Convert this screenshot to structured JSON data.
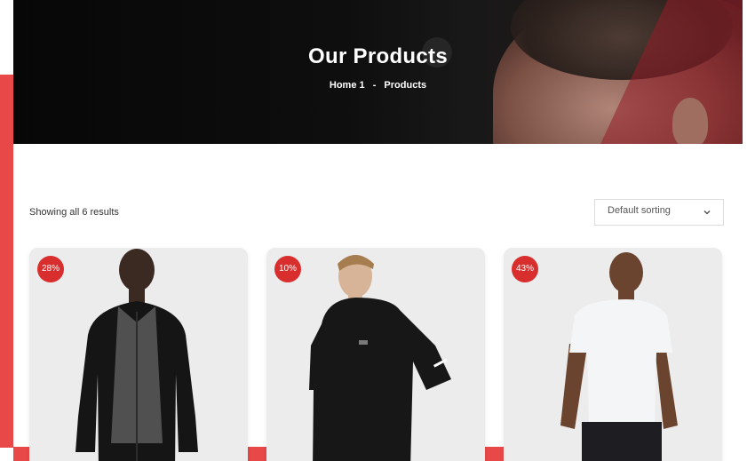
{
  "hero": {
    "title": "Our Products",
    "breadcrumb": {
      "home": "Home 1",
      "separator": "-",
      "current": "Products"
    }
  },
  "shop": {
    "results_count": "Showing all 6 results",
    "sort": {
      "selected": "Default sorting"
    }
  },
  "products": [
    {
      "badge": "28%",
      "image": "man-black-zip-hoodie-grey-tee"
    },
    {
      "badge": "10%",
      "image": "man-black-short-sleeve-hoodie"
    },
    {
      "badge": "43%",
      "image": "man-white-tshirt"
    }
  ],
  "colors": {
    "accent": "#e84848",
    "badge": "#d92e2e",
    "hero_bg": "#0e0e0e",
    "card_bg": "#ececec"
  },
  "icons": {
    "sort_chevron": "chevron-down-icon"
  }
}
